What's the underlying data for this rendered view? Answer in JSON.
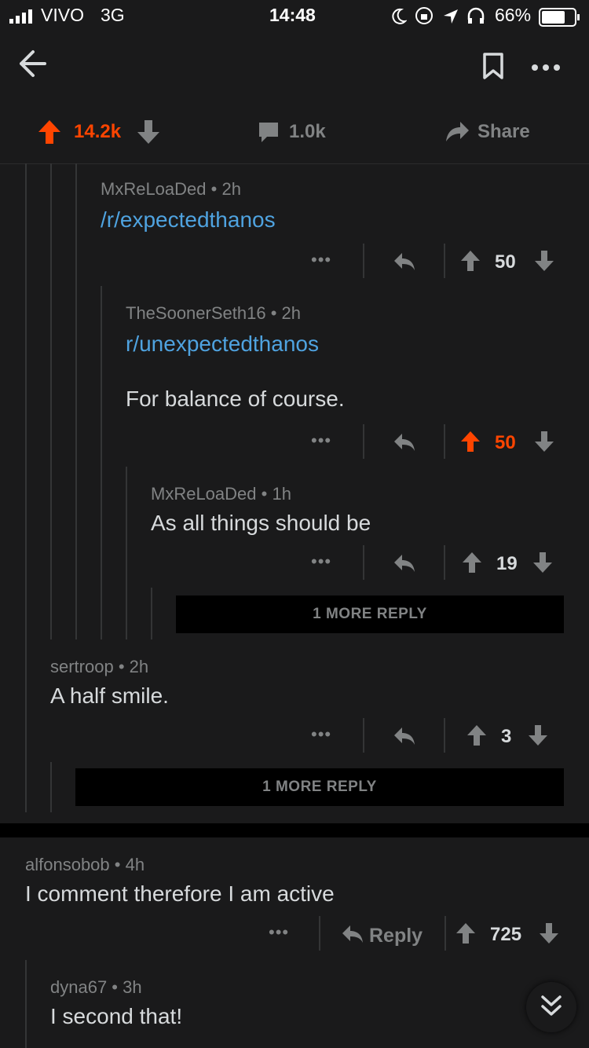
{
  "status_bar": {
    "carrier": "VIVO",
    "network": "3G",
    "time": "14:48",
    "battery": "66%"
  },
  "post_bar": {
    "upvotes": "14.2k",
    "comments": "1.0k",
    "share_label": "Share"
  },
  "comments": [
    {
      "author": "MxReLoaDed",
      "age": "2h",
      "text": "/r/expectedthanos",
      "is_link": true,
      "score": "50",
      "upvoted": false
    },
    {
      "author": "TheSoonerSeth16",
      "age": "2h",
      "link": "r/unexpectedthanos",
      "text": "For balance of course.",
      "score": "50",
      "upvoted": true
    },
    {
      "author": "MxReLoaDed",
      "age": "1h",
      "text": "As all things should be",
      "score": "19",
      "upvoted": false
    },
    {
      "author": "sertroop",
      "age": "2h",
      "text": "A half smile.",
      "score": "3",
      "upvoted": false
    },
    {
      "author": "alfonsobob",
      "age": "4h",
      "text": "I comment therefore I am active",
      "score": "725",
      "reply_label": "Reply",
      "upvoted": false
    },
    {
      "author": "dyna67",
      "age": "3h",
      "text": "I second that!"
    }
  ],
  "more_replies": [
    "1 MORE REPLY",
    "1 MORE REPLY"
  ],
  "colors": {
    "upvote": "#ff4500",
    "link": "#4fa3e0",
    "background": "#1a1a1b"
  }
}
